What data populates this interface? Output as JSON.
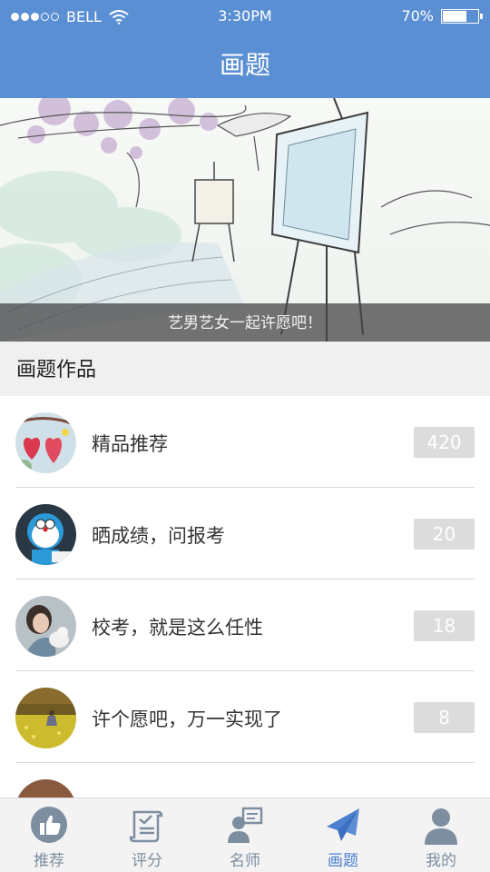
{
  "status_bar": {
    "carrier": "BELL",
    "time": "3:30PM",
    "battery": "70%",
    "battery_level": 0.7,
    "signal_strength": 3,
    "signal_max": 5
  },
  "nav": {
    "title": "画题"
  },
  "banner": {
    "caption": "艺男艺女一起许愿吧！"
  },
  "section": {
    "title": "画题作品"
  },
  "list": {
    "items": [
      {
        "label": "精品推荐",
        "count": "420",
        "avatar_icon": "hearts-avatar"
      },
      {
        "label": "晒成绩，问报考",
        "count": "20",
        "avatar_icon": "doraemon-avatar"
      },
      {
        "label": "校考，就是这么任性",
        "count": "18",
        "avatar_icon": "girl-with-cat-avatar"
      },
      {
        "label": "许个愿吧，万一实现了",
        "count": "8",
        "avatar_icon": "field-avatar"
      }
    ]
  },
  "tabs": [
    {
      "label": "推荐",
      "icon": "thumbs-up-icon",
      "active": false
    },
    {
      "label": "评分",
      "icon": "scroll-icon",
      "active": false
    },
    {
      "label": "名师",
      "icon": "teacher-icon",
      "active": false
    },
    {
      "label": "画题",
      "icon": "paper-plane-icon",
      "active": true
    },
    {
      "label": "我的",
      "icon": "user-icon",
      "active": false
    }
  ],
  "colors": {
    "primary": "#5b8fd3",
    "tab_active": "#4a80d0",
    "tab_inactive": "#7d8ea0",
    "badge_bg": "#dcdcdc"
  }
}
